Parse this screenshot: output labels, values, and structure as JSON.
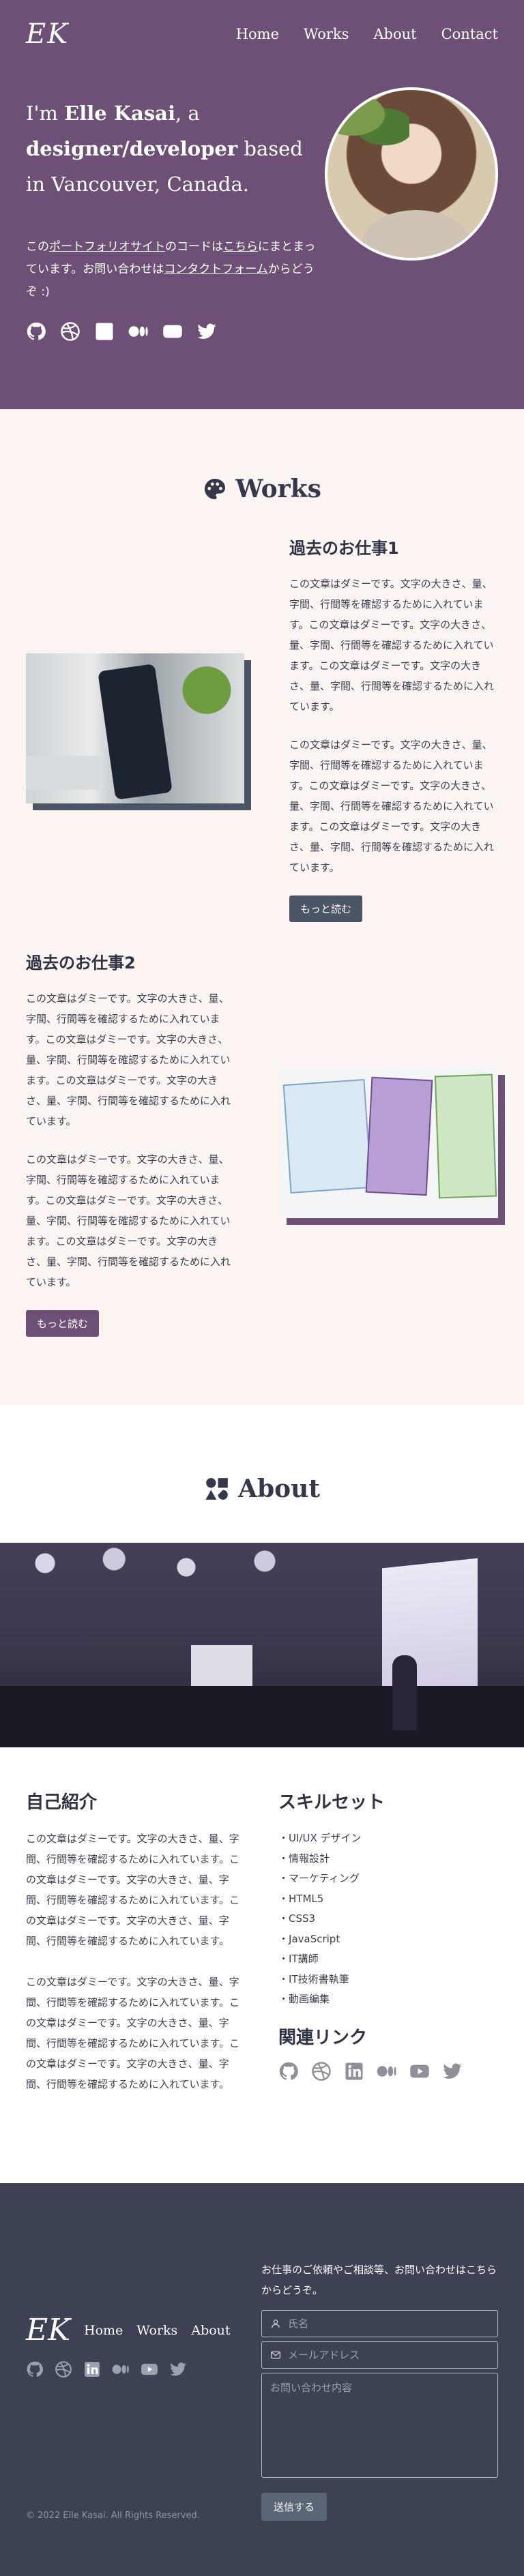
{
  "nav": {
    "logo": "EK",
    "links": [
      "Home",
      "Works",
      "About",
      "Contact"
    ]
  },
  "hero": {
    "title_prefix": "I'm ",
    "title_name": "Elle Kasai",
    "title_mid": ", a ",
    "title_role": "designer/developer",
    "title_suffix": " based in Vancouver, Canada.",
    "desc_1": "この",
    "desc_link_1": "ポートフォリオサイト",
    "desc_2": "のコードは",
    "desc_link_2": "こちら",
    "desc_3": "にまとまっています。お問い合わせは",
    "desc_link_3": "コンタクトフォーム",
    "desc_4": "からどうぞ :)",
    "social_icons": [
      "github-icon",
      "dribbble-icon",
      "linkedin-icon",
      "medium-icon",
      "youtube-icon",
      "twitter-icon"
    ]
  },
  "works": {
    "title": "Works",
    "items": [
      {
        "title": "過去のお仕事1",
        "paragraphs": [
          "この文章はダミーです。文字の大きさ、量、字間、行間等を確認するために入れています。この文章はダミーです。文字の大きさ、量、字間、行間等を確認するために入れています。この文章はダミーです。文字の大きさ、量、字間、行間等を確認するために入れています。",
          "この文章はダミーです。文字の大きさ、量、字間、行間等を確認するために入れています。この文章はダミーです。文字の大きさ、量、字間、行間等を確認するために入れています。この文章はダミーです。文字の大きさ、量、字間、行間等を確認するために入れています。"
        ],
        "button": "もっと読む"
      },
      {
        "title": "過去のお仕事2",
        "paragraphs": [
          "この文章はダミーです。文字の大きさ、量、字間、行間等を確認するために入れています。この文章はダミーです。文字の大きさ、量、字間、行間等を確認するために入れています。この文章はダミーです。文字の大きさ、量、字間、行間等を確認するために入れています。",
          "この文章はダミーです。文字の大きさ、量、字間、行間等を確認するために入れています。この文章はダミーです。文字の大きさ、量、字間、行間等を確認するために入れています。この文章はダミーです。文字の大きさ、量、字間、行間等を確認するために入れています。"
        ],
        "button": "もっと読む"
      }
    ]
  },
  "about": {
    "title": "About",
    "intro_title": "自己紹介",
    "intro_paragraphs": [
      "この文章はダミーです。文字の大きさ、量、字間、行間等を確認するために入れています。この文章はダミーです。文字の大きさ、量、字間、行間等を確認するために入れています。この文章はダミーです。文字の大きさ、量、字間、行間等を確認するために入れています。",
      "この文章はダミーです。文字の大きさ、量、字間、行間等を確認するために入れています。この文章はダミーです。文字の大きさ、量、字間、行間等を確認するために入れています。この文章はダミーです。文字の大きさ、量、字間、行間等を確認するために入れています。"
    ],
    "skills_title": "スキルセット",
    "skills": [
      "UI/UX デザイン",
      "情報設計",
      "マーケティング",
      "HTML5",
      "CSS3",
      "JavaScript",
      "IT講師",
      "IT技術書執筆",
      "動画編集"
    ],
    "links_title": "関連リンク"
  },
  "footer": {
    "logo": "EK",
    "links": [
      "Home",
      "Works",
      "About"
    ],
    "copyright": "© 2022 Elle Kasai. All Rights Reserved.",
    "contact_intro": "お仕事のご依頼やご相談等、お問い合わせはこちらからどうぞ。",
    "name_placeholder": "氏名",
    "email_placeholder": "メールアドレス",
    "message_placeholder": "お問い合わせ内容",
    "send_label": "送信する"
  },
  "colors": {
    "hero_bg": "#6e5077",
    "works_bg": "#fcf3f3",
    "footer_bg": "#3c4254",
    "button_dark": "#4c5566",
    "button_purple": "#6e5077"
  }
}
